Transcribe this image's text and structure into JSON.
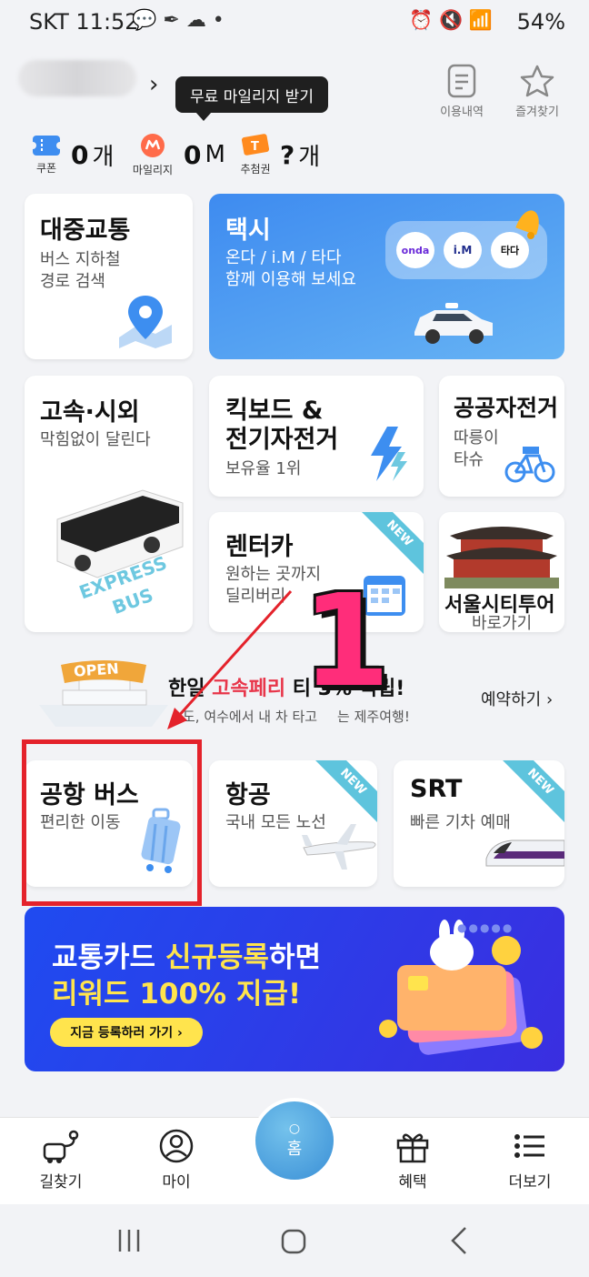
{
  "status": {
    "carrier_time": "SKT 11:52",
    "battery": "54%"
  },
  "header": {
    "tooltip": "무료 마일리지 받기",
    "history_label": "이용내역",
    "favorites_label": "즐겨찾기"
  },
  "stats": [
    {
      "label": "쿠폰",
      "value": "0",
      "unit": "개"
    },
    {
      "label": "마일리지",
      "value": "0",
      "unit": "M"
    },
    {
      "label": "추첨권",
      "value": "?",
      "unit": "개"
    }
  ],
  "cards": {
    "transit": {
      "title": "대중교통",
      "sub1": "버스 지하철",
      "sub2": "경로 검색"
    },
    "taxi": {
      "title": "택시",
      "sub1": "온다 / i.M / 타다",
      "sub2": "함께 이용해 보세요",
      "brands": [
        "onda",
        "i.M",
        "타다"
      ]
    },
    "express": {
      "title": "고속·시외",
      "sub": "막힘없이 달린다",
      "bus_text1": "EXPRESS",
      "bus_text2": "BUS"
    },
    "kickboard": {
      "title1": "킥보드 &",
      "title2": "전기자전거",
      "sub": "보유율 1위"
    },
    "bike": {
      "title": "공공자전거",
      "sub1": "따릉이",
      "sub2": "타슈"
    },
    "rentcar": {
      "title": "렌터카",
      "sub1": "원하는 곳까지",
      "sub2": "딜리버리",
      "badge": "NEW"
    },
    "citytour": {
      "title": "서울시티투어",
      "sub": "바로가기"
    },
    "ferry": {
      "title_pre": "한일",
      "title_hl": "고속페리",
      "title_post": "티",
      "title_tail": "3% 적립!",
      "sub_pre": "도, 여수에서 내 차 타고",
      "sub_post": "는 제주여행!",
      "action": "예약하기 ›",
      "open": "OPEN"
    },
    "airport": {
      "title": "공항 버스",
      "sub": "편리한 이동"
    },
    "air": {
      "title": "항공",
      "sub": "국내 모든 노선",
      "badge": "NEW"
    },
    "srt": {
      "title": "SRT",
      "sub": "빠른 기차 예매",
      "badge": "NEW"
    }
  },
  "annotation": {
    "number": "1"
  },
  "banner": {
    "line1_pre": "교통카드 ",
    "line1_hl": "신규등록",
    "line1_post": "하면",
    "line2": "리워드 100% 지급!",
    "button": "지금 등록하러 가기 ›"
  },
  "nav": {
    "route": "길찾기",
    "my": "마이",
    "home": "홈",
    "benefit": "혜택",
    "more": "더보기"
  },
  "colors": {
    "accent": "#3b8ef0",
    "annotation_red": "#e4222b",
    "number_pink": "#ff2d7a",
    "ferry_red": "#e8364a",
    "banner_yellow": "#ffe44d"
  }
}
